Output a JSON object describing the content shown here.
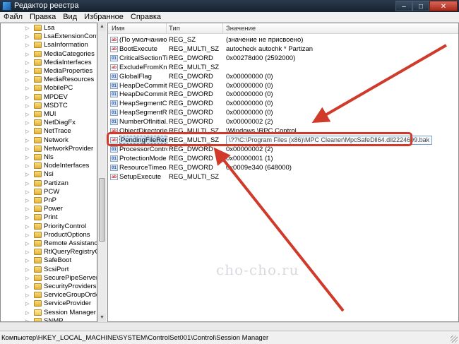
{
  "window": {
    "title": "Редактор реестра",
    "controls": {
      "minimize": "–",
      "maximize": "□",
      "close": "✕"
    }
  },
  "menu": [
    "Файл",
    "Правка",
    "Вид",
    "Избранное",
    "Справка"
  ],
  "tree": {
    "items": [
      {
        "label": "Lsa"
      },
      {
        "label": "LsaExtensionConfig"
      },
      {
        "label": "LsaInformation"
      },
      {
        "label": "MediaCategories"
      },
      {
        "label": "MediaInterfaces"
      },
      {
        "label": "MediaProperties"
      },
      {
        "label": "MediaResources"
      },
      {
        "label": "MobilePC"
      },
      {
        "label": "MPDEV"
      },
      {
        "label": "MSDTC"
      },
      {
        "label": "MUI"
      },
      {
        "label": "NetDiagFx"
      },
      {
        "label": "NetTrace"
      },
      {
        "label": "Network"
      },
      {
        "label": "NetworkProvider"
      },
      {
        "label": "Nls"
      },
      {
        "label": "NodeInterfaces"
      },
      {
        "label": "Nsi"
      },
      {
        "label": "Partizan"
      },
      {
        "label": "PCW"
      },
      {
        "label": "PnP"
      },
      {
        "label": "Power"
      },
      {
        "label": "Print"
      },
      {
        "label": "PriorityControl"
      },
      {
        "label": "ProductOptions"
      },
      {
        "label": "Remote Assistance"
      },
      {
        "label": "RtlQueryRegistryCon"
      },
      {
        "label": "SafeBoot"
      },
      {
        "label": "ScsiPort"
      },
      {
        "label": "SecurePipeServers"
      },
      {
        "label": "SecurityProviders"
      },
      {
        "label": "ServiceGroupOrder"
      },
      {
        "label": "ServiceProvider"
      },
      {
        "label": "Session Manager",
        "open": true
      },
      {
        "label": "SNMP"
      }
    ]
  },
  "values": {
    "headers": {
      "name": "Имя",
      "type": "Тип",
      "data": "Значение"
    },
    "rows": [
      {
        "icon": "ab",
        "kind": "sz",
        "name": "(По умолчанию)",
        "type": "REG_SZ",
        "data": "(значение не присвоено)"
      },
      {
        "icon": "ab",
        "kind": "sz",
        "name": "BootExecute",
        "type": "REG_MULTI_SZ",
        "data": "autocheck autochk * Partizan"
      },
      {
        "icon": "01",
        "kind": "dw",
        "name": "CriticalSectionTi...",
        "type": "REG_DWORD",
        "data": "0x00278d00 (2592000)"
      },
      {
        "icon": "ab",
        "kind": "sz",
        "name": "ExcludeFromKn...",
        "type": "REG_MULTI_SZ",
        "data": ""
      },
      {
        "icon": "01",
        "kind": "dw",
        "name": "GlobalFlag",
        "type": "REG_DWORD",
        "data": "0x00000000 (0)"
      },
      {
        "icon": "01",
        "kind": "dw",
        "name": "HeapDeCommit...",
        "type": "REG_DWORD",
        "data": "0x00000000 (0)"
      },
      {
        "icon": "01",
        "kind": "dw",
        "name": "HeapDeCommit...",
        "type": "REG_DWORD",
        "data": "0x00000000 (0)"
      },
      {
        "icon": "01",
        "kind": "dw",
        "name": "HeapSegmentC...",
        "type": "REG_DWORD",
        "data": "0x00000000 (0)"
      },
      {
        "icon": "01",
        "kind": "dw",
        "name": "HeapSegmentR...",
        "type": "REG_DWORD",
        "data": "0x00000000 (0)"
      },
      {
        "icon": "01",
        "kind": "dw",
        "name": "NumberOfInitial...",
        "type": "REG_DWORD",
        "data": "0x00000002 (2)"
      },
      {
        "icon": "ab",
        "kind": "sz",
        "name": "ObjectDirectories",
        "type": "REG_MULTI_SZ",
        "data": "\\Windows \\RPC Control"
      },
      {
        "icon": "ab",
        "kind": "sz",
        "name": "PendingFileRen...",
        "type": "REG_MULTI_SZ",
        "data": "\\??\\C:\\Program Files (x86)\\MPC Cleaner\\MpcSafeDll64.dll2224699.bak",
        "selected": true
      },
      {
        "icon": "01",
        "kind": "dw",
        "name": "ProcessorControl",
        "type": "REG_DWORD",
        "data": "0x00000002 (2)"
      },
      {
        "icon": "01",
        "kind": "dw",
        "name": "ProtectionMode",
        "type": "REG_DWORD",
        "data": "0x00000001 (1)"
      },
      {
        "icon": "01",
        "kind": "dw",
        "name": "ResourceTimeo...",
        "type": "REG_DWORD",
        "data": "0x0009e340 (648000)"
      },
      {
        "icon": "ab",
        "kind": "sz",
        "name": "SetupExecute",
        "type": "REG_MULTI_SZ",
        "data": ""
      }
    ]
  },
  "status": {
    "path": "Компьютер\\HKEY_LOCAL_MACHINE\\SYSTEM\\ControlSet001\\Control\\Session Manager"
  },
  "watermark": "cho-cho.ru",
  "colors": {
    "annotation": "#cf3a2a",
    "selection": "#cce4f7"
  }
}
